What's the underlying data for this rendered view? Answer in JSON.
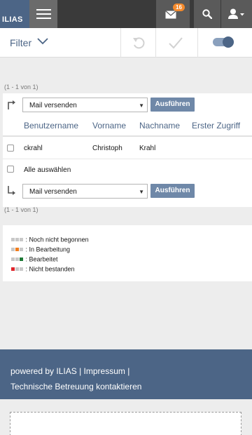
{
  "header": {
    "logo_text": "ILIAS",
    "mail_badge": "16",
    "icons": [
      "menu-icon",
      "mail-icon",
      "search-icon",
      "user-icon"
    ]
  },
  "filter": {
    "label": "Filter",
    "icons": [
      "chevron-down-icon",
      "undo-icon",
      "checkmark-icon",
      "toggle-switch"
    ]
  },
  "pager": {
    "top": "(1 - 1 von 1)",
    "bottom": "(1 - 1 von 1)"
  },
  "actions": {
    "select_value": "Mail versenden",
    "execute_label": "Ausführen"
  },
  "table": {
    "columns": [
      "Benutzername",
      "Vorname",
      "Nachname",
      "Erster Zugriff"
    ],
    "rows": [
      {
        "username": "ckrahl",
        "firstname": "Christoph",
        "lastname": "Krahl",
        "first_access": ""
      }
    ],
    "select_all": "Alle auswählen"
  },
  "legend": {
    "items": [
      {
        "text": ": Noch nicht begonnen",
        "colors": [
          "#c8c8c8",
          "#c8c8c8",
          "#c8c8c8"
        ]
      },
      {
        "text": ": In Bearbeitung",
        "colors": [
          "#c8c8c8",
          "#f07d1e",
          "#c8c8c8"
        ]
      },
      {
        "text": ": Bearbeitet",
        "colors": [
          "#c8c8c8",
          "#c8c8c8",
          "#1e7a36"
        ]
      },
      {
        "text": ": Nicht bestanden",
        "colors": [
          "#e0242b",
          "#c8c8c8",
          "#c8c8c8"
        ]
      }
    ]
  },
  "footer": {
    "powered": "powered by ILIAS",
    "separator": "|",
    "impressum": "Impressum",
    "support": "Technische Betreuung kontaktieren"
  },
  "colors": {
    "brand": "#4c6586",
    "header": "#3a3a3a",
    "badge": "#f58a2c",
    "button": "#6f88a8"
  }
}
